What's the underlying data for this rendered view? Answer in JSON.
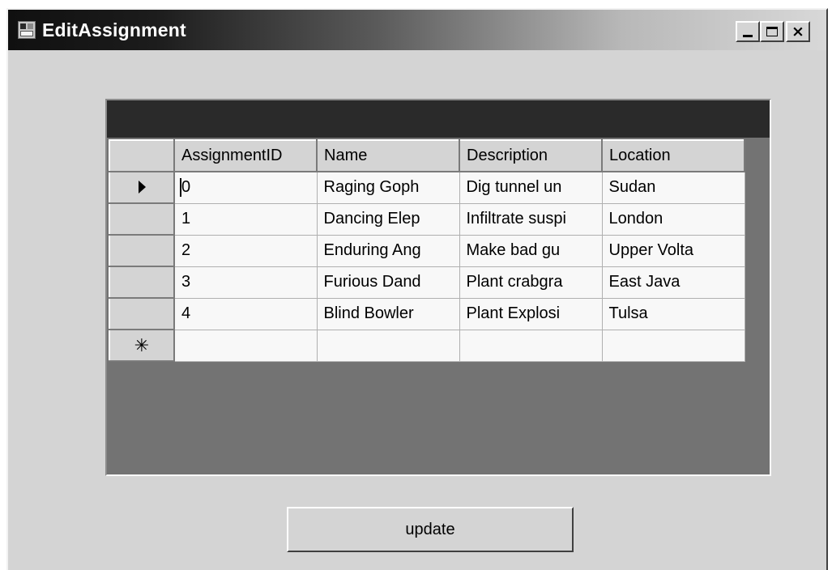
{
  "window": {
    "title": "EditAssignment",
    "controls": {
      "minimize": "_",
      "maximize": "□",
      "close": "×"
    },
    "icon": "form-app-icon"
  },
  "grid": {
    "columns": [
      "AssignmentID",
      "Name",
      "Description",
      "Location"
    ],
    "rows": [
      {
        "indicator": "current",
        "cells": [
          "0",
          "Raging Goph",
          "Dig tunnel un",
          "Sudan"
        ]
      },
      {
        "indicator": "",
        "cells": [
          "1",
          "Dancing Elep",
          "Infiltrate suspi",
          "London"
        ]
      },
      {
        "indicator": "",
        "cells": [
          "2",
          "Enduring Ang",
          "Make bad gu",
          "Upper Volta"
        ]
      },
      {
        "indicator": "",
        "cells": [
          "3",
          "Furious Dand",
          "Plant crabgra",
          "East Java"
        ]
      },
      {
        "indicator": "",
        "cells": [
          "4",
          "Blind Bowler",
          "Plant Explosi",
          "Tulsa"
        ]
      }
    ],
    "new_row_marker": "✳"
  },
  "buttons": {
    "update_label": "update"
  }
}
